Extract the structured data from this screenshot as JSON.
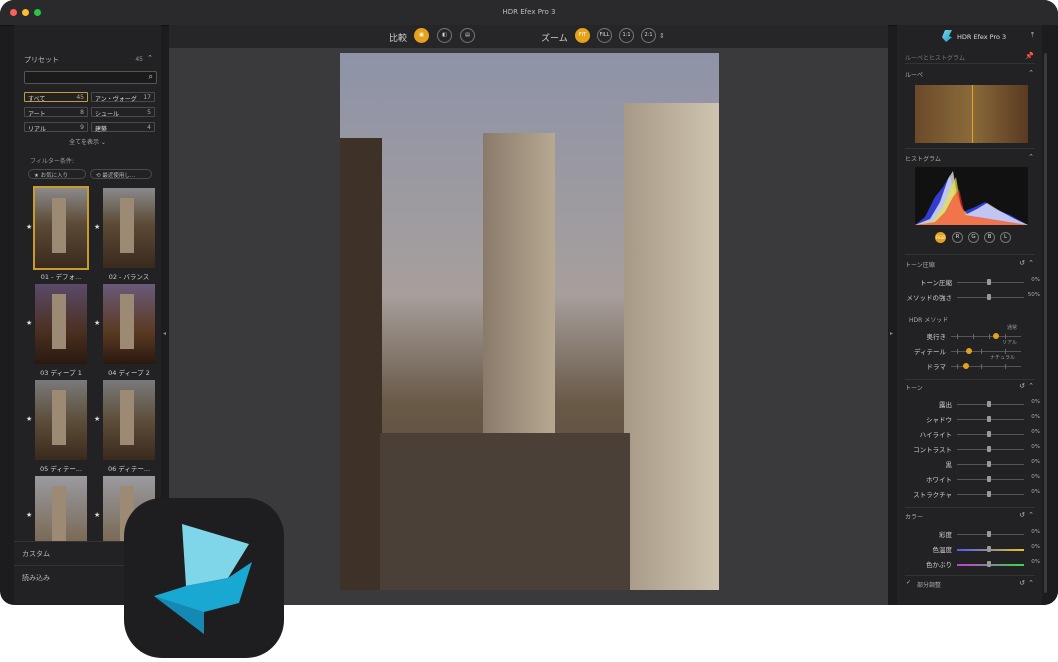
{
  "window": {
    "title": "HDR Efex Pro 3"
  },
  "left_panel": {
    "presets_label": "プリセット",
    "presets_count": "45",
    "search_placeholder": "",
    "categories": [
      {
        "label": "すべて",
        "count": "45",
        "active": true
      },
      {
        "label": "アン・ヴォーグ",
        "count": "17"
      },
      {
        "label": "アート",
        "count": "8"
      },
      {
        "label": "シュール",
        "count": "5"
      },
      {
        "label": "リアル",
        "count": "9"
      },
      {
        "label": "建築",
        "count": "4"
      }
    ],
    "show_all": "全てを表示",
    "filter_label": "フィルター条件:",
    "filters": [
      "★ お気に入り",
      "⟲ 最近使用し..."
    ],
    "thumbnails": [
      "01 - デフォ...",
      "02 - バランス",
      "03 ディープ 1",
      "04 ディープ 2",
      "05 ディテー...",
      "06 ディテー..."
    ],
    "custom_label": "カスタム",
    "import_label": "読み込み"
  },
  "toolbar": {
    "compare_label": "比較",
    "zoom_label": "ズーム",
    "zoom_buttons": [
      "FIT",
      "FILL",
      "1:1",
      "2:1"
    ]
  },
  "right_panel": {
    "app_name": "HDR Efex Pro 3",
    "loupe_histogram_label": "ルーペとヒストグラム",
    "loupe_label": "ルーペ",
    "histogram_label": "ヒストグラム",
    "channels": [
      "RGB",
      "R",
      "G",
      "B",
      "L"
    ],
    "tone_compression": {
      "title": "トーン圧縮",
      "sliders": [
        {
          "label": "トーン圧縮",
          "value": "0%"
        },
        {
          "label": "メソッドの強さ",
          "value": "50%"
        }
      ]
    },
    "hdr_method": {
      "title": "HDR メソッド",
      "rows": [
        {
          "label": "奥行き",
          "tag": "通常"
        },
        {
          "label": "ディテール",
          "tag": "リアル"
        },
        {
          "label": "ドラマ",
          "tag": "ナチュラル"
        }
      ]
    },
    "tone": {
      "title": "トーン",
      "sliders": [
        {
          "label": "露出",
          "value": "0%"
        },
        {
          "label": "シャドウ",
          "value": "0%"
        },
        {
          "label": "ハイライト",
          "value": "0%"
        },
        {
          "label": "コントラスト",
          "value": "0%"
        },
        {
          "label": "黒",
          "value": "0%"
        },
        {
          "label": "ホワイト",
          "value": "0%"
        },
        {
          "label": "ストラクチャ",
          "value": "0%"
        }
      ]
    },
    "color": {
      "title": "カラー",
      "sliders": [
        {
          "label": "彩度",
          "value": "0%"
        },
        {
          "label": "色温度",
          "value": "0%"
        },
        {
          "label": "色かぶり",
          "value": "0%"
        }
      ]
    },
    "partial_adjust": "部分調整"
  },
  "colors": {
    "accent": "#e5a21c",
    "panel": "#222224",
    "canvas": "#3a3a3c"
  }
}
